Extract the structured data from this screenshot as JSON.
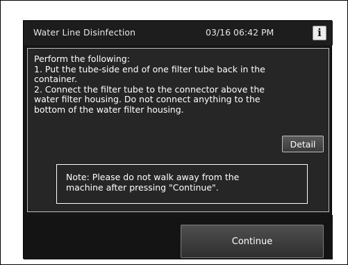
{
  "header": {
    "title": "Water Line Disinfection",
    "datetime": "03/16 06:42 PM",
    "info_icon_glyph": "i"
  },
  "instructions": {
    "lines": [
      "Perform the following:",
      "1. Put the tube-side end of one filter tube back in the",
      "container.",
      "2. Connect the filter tube to the connector above the",
      "water filter housing. Do not connect anything to the",
      "bottom of the water filter housing."
    ]
  },
  "detail_button": {
    "label": "Detail"
  },
  "note": {
    "lines": [
      "Note: Please do not walk away from the",
      "machine after pressing \"Continue\"."
    ]
  },
  "continue_button": {
    "label": "Continue"
  },
  "colors": {
    "screen_background": "#151515",
    "panel_background": "#262626",
    "text": "#ffffff"
  }
}
